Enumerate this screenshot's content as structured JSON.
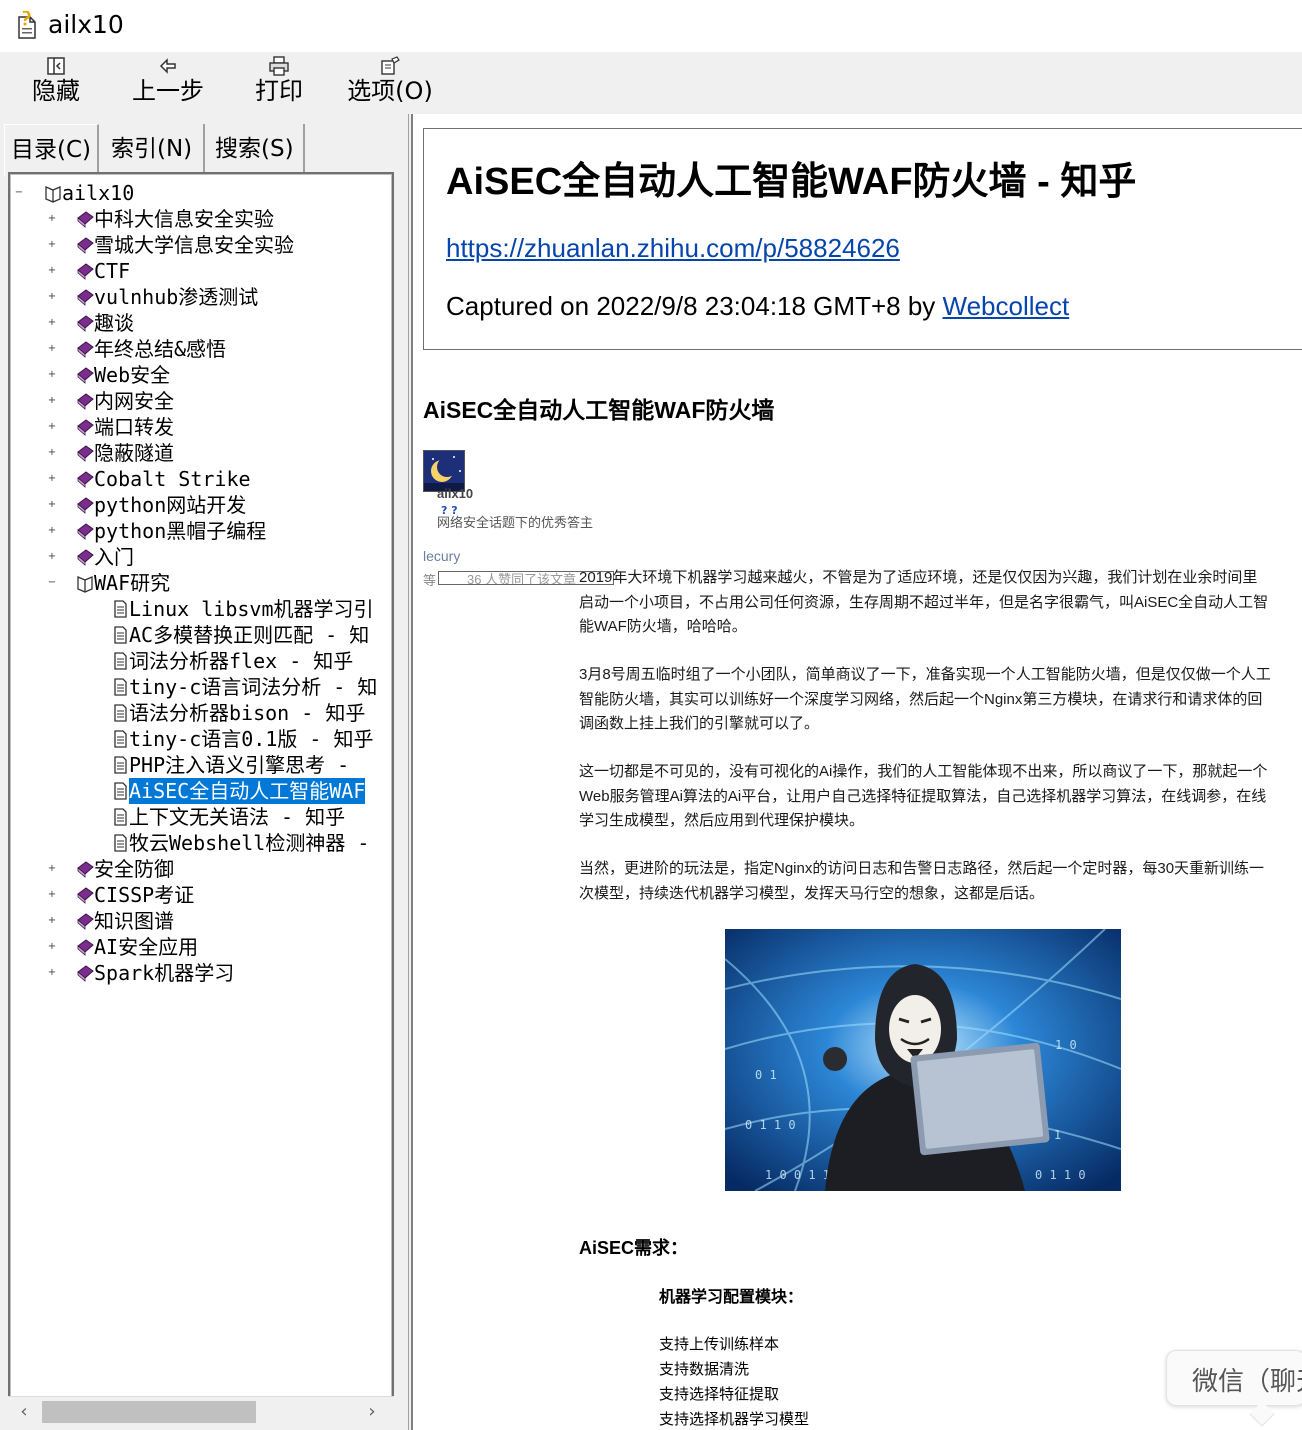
{
  "window": {
    "title": "ailx10",
    "icon": "help-document-icon"
  },
  "toolbar": {
    "hide_label": "隐藏",
    "back_label": "上一步",
    "print_label": "打印",
    "options_label": "选项(O)"
  },
  "tabs": [
    "目录(C)",
    "索引(N)",
    "搜索(S)"
  ],
  "tree": {
    "root": "ailx10",
    "items": [
      "中科大信息安全实验",
      "雪城大学信息安全实验",
      "CTF",
      "vulnhub渗透测试",
      "趣谈",
      "年终总结&感悟",
      "Web安全",
      "内网安全",
      "端口转发",
      "隐蔽隧道",
      "Cobalt Strike",
      "python网站开发",
      "python黑帽子编程",
      "入门",
      "WAF研究"
    ],
    "waf_children": [
      "Linux libsvm机器学习引",
      "AC多模替换正则匹配 - 知",
      "词法分析器flex - 知乎",
      "tiny-c语言词法分析 - 知",
      "语法分析器bison - 知乎",
      "tiny-c语言0.1版 - 知乎",
      "PHP注入语义引擎思考 -",
      "AiSEC全自动人工智能WAF",
      "上下文无关语法 - 知乎",
      "牧云Webshell检测神器 -"
    ],
    "after_items": [
      "安全防御",
      "CISSP考证",
      "知识图谱",
      "AI安全应用",
      "Spark机器学习"
    ]
  },
  "content": {
    "page_title": "AiSEC全自动人工智能WAF防火墙 - 知乎",
    "url": "https://zhuanlan.zhihu.com/p/58824626",
    "captured_prefix": "Captured on 2022/9/8 23:04:18 GMT+8 by ",
    "captured_by": "Webcollect",
    "article_title": "AiSEC全自动人工智能WAF防火墙",
    "author": "ailx10",
    "author_badge": "? ?",
    "author_desc": "网络安全话题下的优秀答主",
    "liker": "lecury",
    "like_prefix": "等",
    "like_text": "36 人赞同了该文章",
    "paragraphs": [
      "2019年大环境下机器学习越来越火，不管是为了适应环境，还是仅仅因为兴趣，我们计划在业余时间里启动一个小项目，不占用公司任何资源，生存周期不超过半年，但是名字很霸气，叫AiSEC全自动人工智能WAF防火墙，哈哈哈。",
      "3月8号周五临时组了一个小团队，简单商议了一下，准备实现一个人工智能防火墙，但是仅仅做一个人工智能防火墙，其实可以训练好一个深度学习网络，然后起一个Nginx第三方模块，在请求行和请求体的回调函数上挂上我们的引擎就可以了。",
      "这一切都是不可见的，没有可视化的Ai操作，我们的人工智能体现不出来，所以商议了一下，那就起一个Web服务管理Ai算法的Ai平台，让用户自己选择特征提取算法，自己选择机器学习算法，在线调参，在线学习生成模型，然后应用到代理保护模块。",
      "当然，更进阶的玩法是，指定Nginx的访问日志和告警日志路径，然后起一个定时器，每30天重新训练一次模型，持续迭代机器学习模型，发挥天马行空的想象，这都是后话。"
    ],
    "section_heading": "AiSEC需求：",
    "sub_heading": "机器学习配置模块：",
    "features": [
      "支持上传训练样本",
      "支持数据清洗",
      "支持选择特征提取",
      "支持选择机器学习模型"
    ]
  },
  "wechat_popup": "微信（聊天"
}
